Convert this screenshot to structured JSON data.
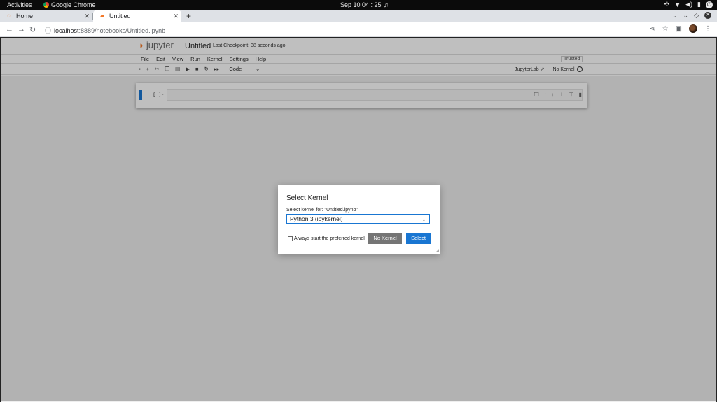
{
  "topbar": {
    "activities": "Activities",
    "app_name": "Google Chrome",
    "clock": "Sep 10  04 : 25"
  },
  "tabs": [
    {
      "label": "Home",
      "active": false
    },
    {
      "label": "Untitled",
      "active": true
    }
  ],
  "address": {
    "host": "localhost",
    "path": ":8889/notebooks/Untitled.ipynb"
  },
  "jupyter": {
    "logo_text": "jupyter",
    "notebook_title": "Untitled",
    "checkpoint": "Last Checkpoint: 38 seconds ago",
    "menu": [
      "File",
      "Edit",
      "View",
      "Run",
      "Kernel",
      "Settings",
      "Help"
    ],
    "trusted": "Trusted",
    "cell_type": "Code",
    "jupyterlab_link": "JupyterLab",
    "kernel_status": "No Kernel",
    "cell_prompt": "[ ]:"
  },
  "dialog": {
    "title": "Select Kernel",
    "label": "Select kernel for: \"Untitled.ipynb\"",
    "selected_kernel": "Python 3 (ipykernel)",
    "checkbox_label": "Always start the preferred kernel",
    "no_kernel_button": "No Kernel",
    "select_button": "Select"
  },
  "colors": {
    "accent": "#1976d2",
    "jupyter_orange": "#f37726",
    "secondary_button": "#757575"
  }
}
